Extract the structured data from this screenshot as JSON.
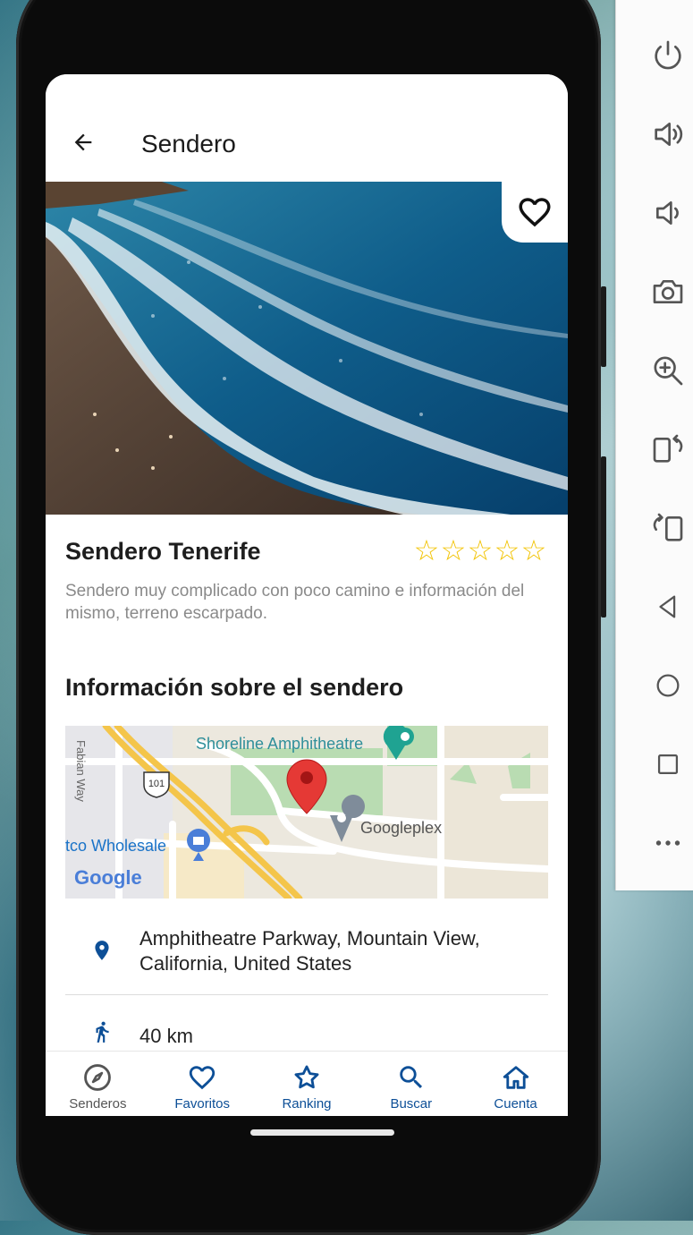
{
  "app": {
    "title": "Sendero",
    "back_label": "Volver"
  },
  "trail": {
    "name": "Sendero Tenerife",
    "rating": 0,
    "rating_max": 5,
    "description": "Sendero muy complicado con poco camino e información del mismo, terreno escarpado.",
    "favorite": false
  },
  "info": {
    "section_title": "Información sobre el sendero",
    "address": "Amphitheatre Parkway, Mountain View, California, United States",
    "distance": "40 km"
  },
  "map": {
    "labels": {
      "amphitheatre": "Shoreline Amphitheatre",
      "googleplex": "Googleplex",
      "wholesale": "tco Wholesale",
      "road": "Fabian Way",
      "highway": "101",
      "logo": "Google"
    }
  },
  "nav": {
    "items": [
      {
        "label": "Senderos",
        "icon": "compass-icon",
        "active": false
      },
      {
        "label": "Favoritos",
        "icon": "heart-icon",
        "active": true
      },
      {
        "label": "Ranking",
        "icon": "star-icon",
        "active": true
      },
      {
        "label": "Buscar",
        "icon": "search-icon",
        "active": true
      },
      {
        "label": "Cuenta",
        "icon": "home-icon",
        "active": true
      }
    ]
  },
  "emulator": {
    "controls": [
      "power-icon",
      "volume-up-icon",
      "volume-down-icon",
      "camera-icon",
      "zoom-in-icon",
      "rotate-right-icon",
      "rotate-left-icon",
      "back-triangle-icon",
      "home-circle-icon",
      "overview-square-icon",
      "more-icon"
    ]
  },
  "colors": {
    "accent": "#0d4f97",
    "star": "#f2c300",
    "map_pin": "#e53935"
  }
}
